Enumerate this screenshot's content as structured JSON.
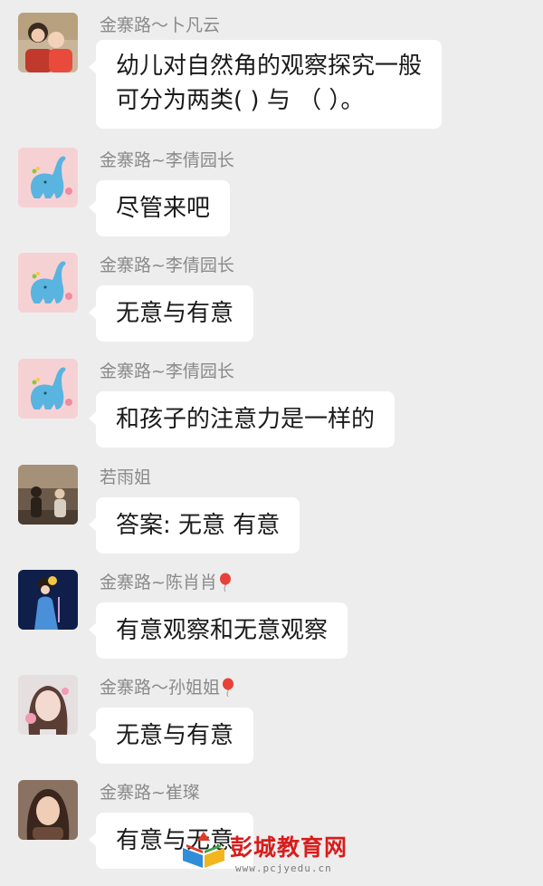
{
  "messages": [
    {
      "sender": "金寨路～卜凡云",
      "avatar": "photo-mother-and-child",
      "text": "幼儿对自然角的观察探究一般\n可分为两类(  )  与 （  ）。",
      "balloon": false
    },
    {
      "sender": "金寨路~李倩园长",
      "avatar": "cartoon-blue-dinosaur",
      "text": "尽管来吧",
      "balloon": false
    },
    {
      "sender": "金寨路~李倩园长",
      "avatar": "cartoon-blue-dinosaur",
      "text": "无意与有意",
      "balloon": false
    },
    {
      "sender": "金寨路~李倩园长",
      "avatar": "cartoon-blue-dinosaur",
      "text": "和孩子的注意力是一样的",
      "balloon": false
    },
    {
      "sender": "若雨姐",
      "avatar": "photo-two-people-sepia",
      "text": "答案: 无意 有意",
      "balloon": false
    },
    {
      "sender": "金寨路~陈肖肖",
      "avatar": "illustration-girl-blue-dress",
      "text": "有意观察和无意观察",
      "balloon": true
    },
    {
      "sender": "金寨路～孙姐姐",
      "avatar": "photo-girl-with-stickers",
      "text": "无意与有意",
      "balloon": true
    },
    {
      "sender": "金寨路~崔璨",
      "avatar": "photo-woman-portrait",
      "text": "有意与无意",
      "balloon": false
    }
  ],
  "watermark": {
    "title": "彭城教育网",
    "url": "www.pcjyedu.cn"
  },
  "colors": {
    "background": "#ededed",
    "bubble": "#ffffff",
    "sender_name": "#8a8a8a",
    "watermark_title": "#d81c1c"
  }
}
